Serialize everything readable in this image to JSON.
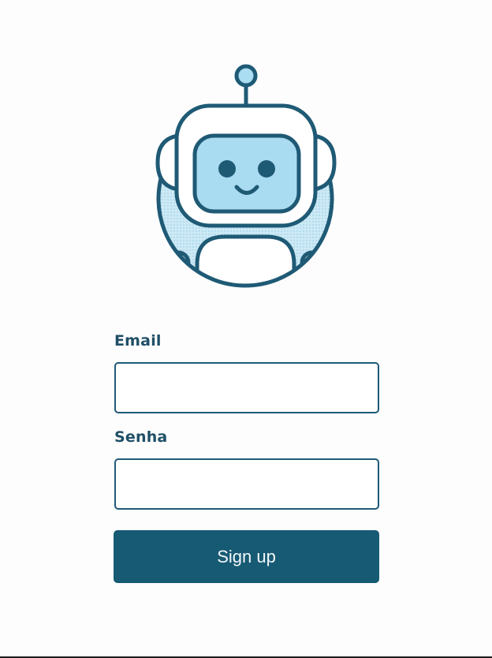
{
  "logo": {
    "icon": "robot-icon",
    "accent_color": "#1f5a75",
    "fill_color": "#aadcf2"
  },
  "form": {
    "email_label": "Email",
    "email_value": "",
    "password_label": "Senha",
    "password_value": "",
    "submit_label": "Sign up",
    "button_color": "#175a73"
  }
}
